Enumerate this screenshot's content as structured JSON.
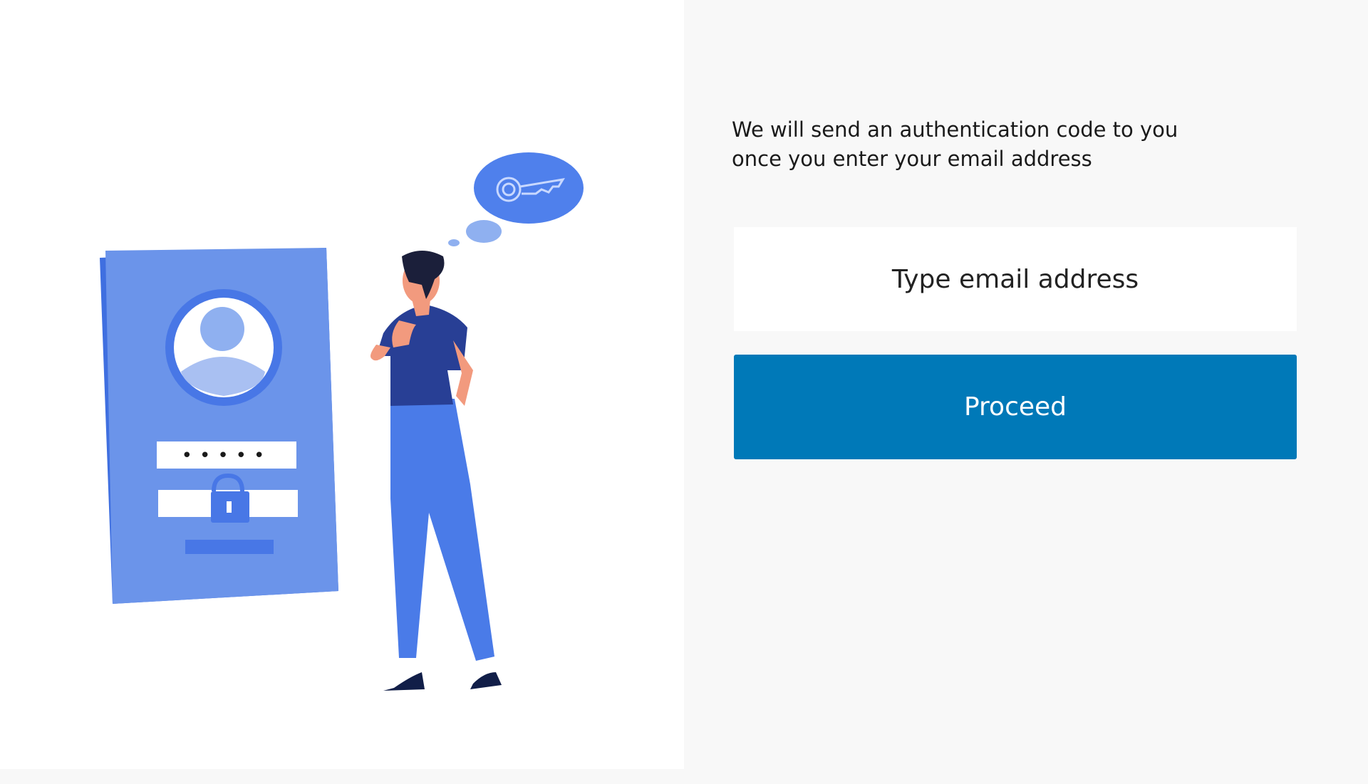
{
  "intro": {
    "line1": "We will send an authentication code to you",
    "line2": "once you enter your email address"
  },
  "email": {
    "placeholder": "Type email address",
    "value": ""
  },
  "proceed": {
    "label": "Proceed"
  },
  "illustration": {
    "masked_password": "•••••",
    "icons": [
      "user-avatar-icon",
      "lock-icon",
      "key-icon"
    ]
  },
  "colors": {
    "primary_button": "#0079b8",
    "illustration_blue": "#5b87e8",
    "illustration_dark": "#2c4a9e",
    "panel_background": "#f8f8f8"
  }
}
